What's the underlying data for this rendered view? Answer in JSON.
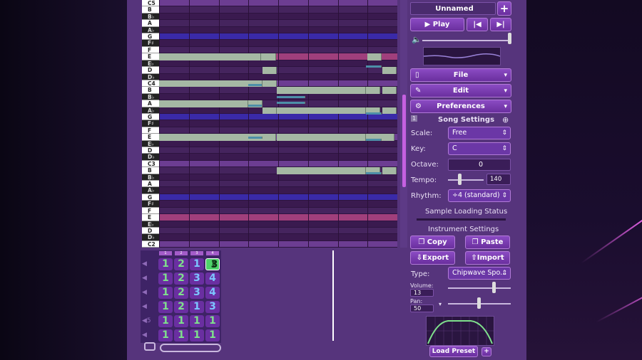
{
  "piano_keys": [
    {
      "label": "C5",
      "color": "w"
    },
    {
      "label": "B",
      "color": "w"
    },
    {
      "label": "B♭",
      "color": "b"
    },
    {
      "label": "A",
      "color": "w"
    },
    {
      "label": "A♭",
      "color": "b"
    },
    {
      "label": "G",
      "color": "w"
    },
    {
      "label": "F♯",
      "color": "b"
    },
    {
      "label": "F",
      "color": "w"
    },
    {
      "label": "E",
      "color": "w"
    },
    {
      "label": "E♭",
      "color": "b"
    },
    {
      "label": "D",
      "color": "w"
    },
    {
      "label": "D♭",
      "color": "b"
    },
    {
      "label": "C4",
      "color": "w"
    },
    {
      "label": "B",
      "color": "w"
    },
    {
      "label": "B♭",
      "color": "b"
    },
    {
      "label": "A",
      "color": "w"
    },
    {
      "label": "A♭",
      "color": "b"
    },
    {
      "label": "G",
      "color": "w"
    },
    {
      "label": "F♯",
      "color": "b"
    },
    {
      "label": "F",
      "color": "w"
    },
    {
      "label": "E",
      "color": "w"
    },
    {
      "label": "E♭",
      "color": "b"
    },
    {
      "label": "D",
      "color": "w"
    },
    {
      "label": "D♭",
      "color": "b"
    },
    {
      "label": "C3",
      "color": "w"
    },
    {
      "label": "B",
      "color": "w"
    },
    {
      "label": "B♭",
      "color": "b"
    },
    {
      "label": "A",
      "color": "w"
    },
    {
      "label": "A♭",
      "color": "b"
    },
    {
      "label": "G",
      "color": "w"
    },
    {
      "label": "F♯",
      "color": "b"
    },
    {
      "label": "F",
      "color": "w"
    },
    {
      "label": "E",
      "color": "w"
    },
    {
      "label": "E♭",
      "color": "b"
    },
    {
      "label": "D",
      "color": "w"
    },
    {
      "label": "D♭",
      "color": "b"
    },
    {
      "label": "C2",
      "color": "w"
    }
  ],
  "song": {
    "title": "Unnamed",
    "add_icon": "plus-icon"
  },
  "transport": {
    "play_label": "Play",
    "prev_icon": "skip-back-icon",
    "next_icon": "skip-forward-icon",
    "volume_icon": "speaker-icon"
  },
  "menus": {
    "file": "File",
    "edit": "Edit",
    "preferences": "Preferences"
  },
  "song_settings": {
    "heading": "Song Settings",
    "scale_label": "Scale:",
    "scale_value": "Free",
    "key_label": "Key:",
    "key_value": "C",
    "octave_label": "Octave:",
    "octave_value": "0",
    "tempo_label": "Tempo:",
    "tempo_value": "140",
    "rhythm_label": "Rhythm:",
    "rhythm_value": "÷4 (standard)"
  },
  "sample_loading": "Sample Loading Status",
  "instrument": {
    "heading": "Instrument Settings",
    "copy": "Copy",
    "paste": "Paste",
    "export": "Export",
    "import": "Import",
    "type_label": "Type:",
    "type_value": "Chipwave Spo...",
    "volume_label": "Volume:",
    "volume_value": "13",
    "pan_label": "Pan:",
    "pan_value": "50",
    "load_preset": "Load Preset",
    "preset_add": "+"
  },
  "bar_numbers": [
    "1",
    "2",
    "3",
    "4"
  ],
  "pattern_rows": [
    {
      "cells": [
        "1",
        "2",
        "1",
        "3"
      ],
      "type": "pitch"
    },
    {
      "cells": [
        "1",
        "2",
        "3",
        "4"
      ],
      "type": "pitch"
    },
    {
      "cells": [
        "1",
        "2",
        "3",
        "4"
      ],
      "type": "pitch"
    },
    {
      "cells": [
        "1",
        "2",
        "1",
        "3"
      ],
      "type": "pitch"
    },
    {
      "cells": [
        "1",
        "1",
        "1",
        "1"
      ],
      "type": "noise",
      "num": "5"
    },
    {
      "cells": [
        "1",
        "1",
        "1",
        "1"
      ],
      "type": "noise",
      "num": ""
    }
  ],
  "colors": {
    "accent": "#8b4bc3",
    "selected_pattern": "#4fd36b",
    "note": "#a5b8a4"
  }
}
